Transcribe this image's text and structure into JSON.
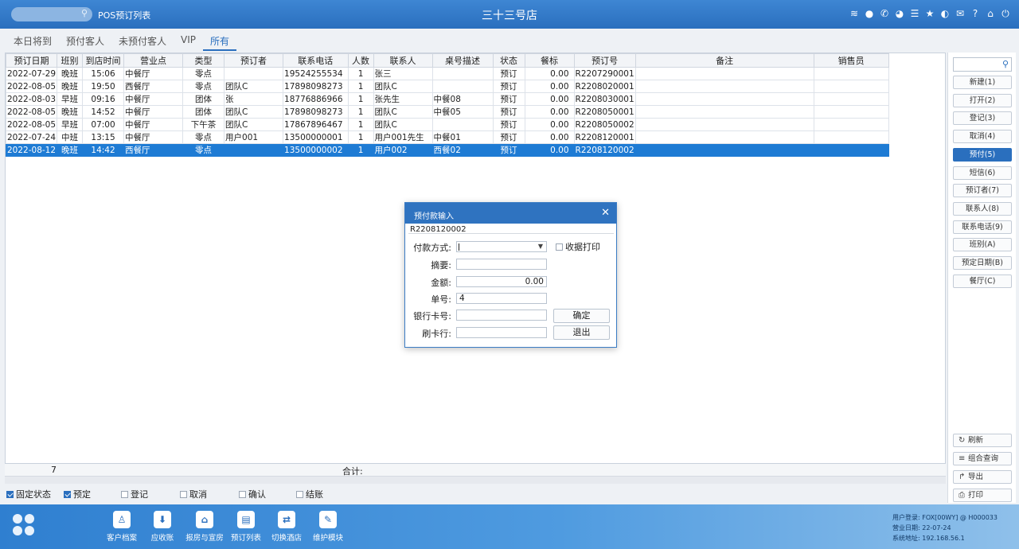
{
  "app": {
    "title": "POS预订列表",
    "store_name": "三十三号店",
    "search_icon_glyph": "⚲",
    "top_icons": [
      "wifi-icon",
      "chat-icon",
      "phone-icon",
      "palette-icon",
      "menu-icon",
      "star-icon",
      "theme-icon",
      "mail-icon",
      "help-icon",
      "home-icon",
      "power-icon"
    ]
  },
  "tabs": [
    {
      "label": "本日将到"
    },
    {
      "label": "预付客人"
    },
    {
      "label": "未预付客人"
    },
    {
      "label": "VIP"
    },
    {
      "label": "所有"
    }
  ],
  "grid": {
    "headers": [
      "预订日期",
      "班别",
      "到店时间",
      "营业点",
      "类型",
      "预订者",
      "联系电话",
      "人数",
      "联系人",
      "桌号描述",
      "状态",
      "餐标",
      "预订号",
      "备注",
      "销售员"
    ],
    "rows": [
      [
        "2022-07-29",
        "晚班",
        "15:06",
        "中餐厅",
        "零点",
        "",
        "19524255534",
        "1",
        "张三",
        "",
        "预订",
        "0.00",
        "R2207290001",
        "",
        ""
      ],
      [
        "2022-08-05",
        "晚班",
        "19:50",
        "西餐厅",
        "零点",
        "团队C",
        "17898098273",
        "1",
        "团队C",
        "",
        "预订",
        "0.00",
        "R2208020001",
        "",
        ""
      ],
      [
        "2022-08-03",
        "早班",
        "09:16",
        "中餐厅",
        "团体",
        "张",
        "18776886966",
        "1",
        "张先生",
        "中餐08",
        "预订",
        "0.00",
        "R2208030001",
        "",
        ""
      ],
      [
        "2022-08-05",
        "晚班",
        "14:52",
        "中餐厅",
        "团体",
        "团队C",
        "17898098273",
        "1",
        "团队C",
        "中餐05",
        "预订",
        "0.00",
        "R2208050001",
        "",
        ""
      ],
      [
        "2022-08-05",
        "早班",
        "07:00",
        "中餐厅",
        "下午茶",
        "团队C",
        "17867896467",
        "1",
        "团队C",
        "",
        "预订",
        "0.00",
        "R2208050002",
        "",
        ""
      ],
      [
        "2022-07-24",
        "中班",
        "13:15",
        "中餐厅",
        "零点",
        "用户001",
        "13500000001",
        "1",
        "用户001先生",
        "中餐01",
        "预订",
        "0.00",
        "R2208120001",
        "",
        ""
      ],
      [
        "2022-08-12",
        "晚班",
        "14:42",
        "西餐厅",
        "零点",
        "",
        "13500000002",
        "1",
        "用户002",
        "西餐02",
        "预订",
        "0.00",
        "R2208120002",
        "",
        ""
      ]
    ],
    "selected_index": 6,
    "footer_count": "7",
    "footer_sum_label": "合计:"
  },
  "status_checks": [
    {
      "label": "固定状态",
      "checked": true
    },
    {
      "label": "预定",
      "checked": true
    },
    {
      "label": "登记",
      "checked": false
    },
    {
      "label": "取消",
      "checked": false
    },
    {
      "label": "确认",
      "checked": false
    },
    {
      "label": "结账",
      "checked": false
    }
  ],
  "right_panel": {
    "search_placeholder": "",
    "buttons": [
      {
        "label": "新建(1)",
        "active": false
      },
      {
        "label": "打开(2)",
        "active": false
      },
      {
        "label": "登记(3)",
        "active": false
      },
      {
        "label": "取消(4)",
        "active": false
      },
      {
        "label": "预付(5)",
        "active": true
      },
      {
        "label": "短信(6)",
        "active": false
      },
      {
        "label": "预订者(7)",
        "active": false
      },
      {
        "label": "联系人(8)",
        "active": false
      },
      {
        "label": "联系电话(9)",
        "active": false
      },
      {
        "label": "班别(A)",
        "active": false
      },
      {
        "label": "预定日期(B)",
        "active": false
      },
      {
        "label": "餐厅(C)",
        "active": false
      }
    ],
    "tools": [
      {
        "label": "刷新",
        "icon": "refresh-icon",
        "glyph": "↻"
      },
      {
        "label": "组合查询",
        "icon": "list-icon",
        "glyph": "≡"
      },
      {
        "label": "导出",
        "icon": "export-icon",
        "glyph": "↱"
      },
      {
        "label": "打印",
        "icon": "printer-icon",
        "glyph": "⎙"
      }
    ]
  },
  "dock": {
    "items": [
      {
        "label": "客户档案",
        "icon": "customer-file-icon",
        "glyph": "♙"
      },
      {
        "label": "应收账",
        "icon": "receivable-icon",
        "glyph": "⬇"
      },
      {
        "label": "报房与宣房",
        "icon": "house-icon",
        "glyph": "⌂"
      },
      {
        "label": "预订列表",
        "icon": "booking-list-icon",
        "glyph": "▤"
      },
      {
        "label": "切换酒店",
        "icon": "switch-icon",
        "glyph": "⇄"
      },
      {
        "label": "维护模块",
        "icon": "wrench-icon",
        "glyph": "✎"
      }
    ],
    "info": {
      "user": "用户登录: FOX[00WY] @ H000033",
      "business_date": "营业日期: 22-07-24",
      "address": "系统地址: 192.168.56.1"
    }
  },
  "dialog": {
    "title": "预付款输入",
    "order_no": "R2208120002",
    "pay_method_label": "付款方式:",
    "pay_method_value": "",
    "receipt_print_label": "收据打印",
    "summary_label": "摘要:",
    "summary_value": "",
    "amount_label": "金额:",
    "amount_value": "0.00",
    "bill_no_label": "单号:",
    "bill_no_value": "4",
    "bank_card_label": "银行卡号:",
    "bank_card_value": "",
    "swipe_bank_label": "刷卡行:",
    "swipe_bank_value": "",
    "ok_label": "确定",
    "exit_label": "退出"
  }
}
